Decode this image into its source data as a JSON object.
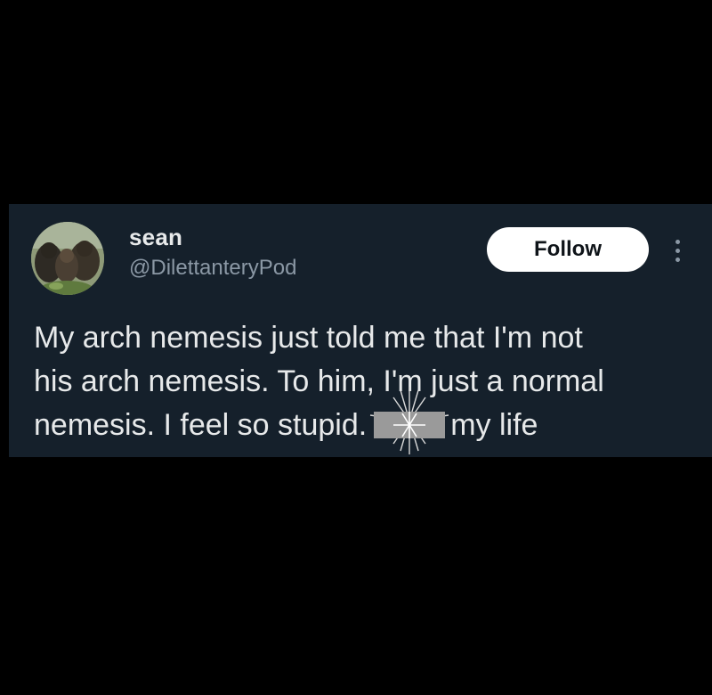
{
  "tweet": {
    "display_name": "sean",
    "handle": "@DilettanteryPod",
    "follow_label": "Follow",
    "more_icon": "more-vertical-icon",
    "text_line1": "My arch nemesis just told me that I'm not",
    "text_line2": "his arch nemesis. To him, I'm just a normal",
    "text_line3_before": "nemesis. I feel so stupid.",
    "text_line3_after": "my life",
    "censor_icon": "censored-bar-icon"
  },
  "colors": {
    "page_background": "#000000",
    "card_background": "#15202b",
    "primary_text": "#e7e9ea",
    "secondary_text": "#8b98a5",
    "follow_button_bg": "#ffffff",
    "censor_gray": "#9a9a9a"
  }
}
